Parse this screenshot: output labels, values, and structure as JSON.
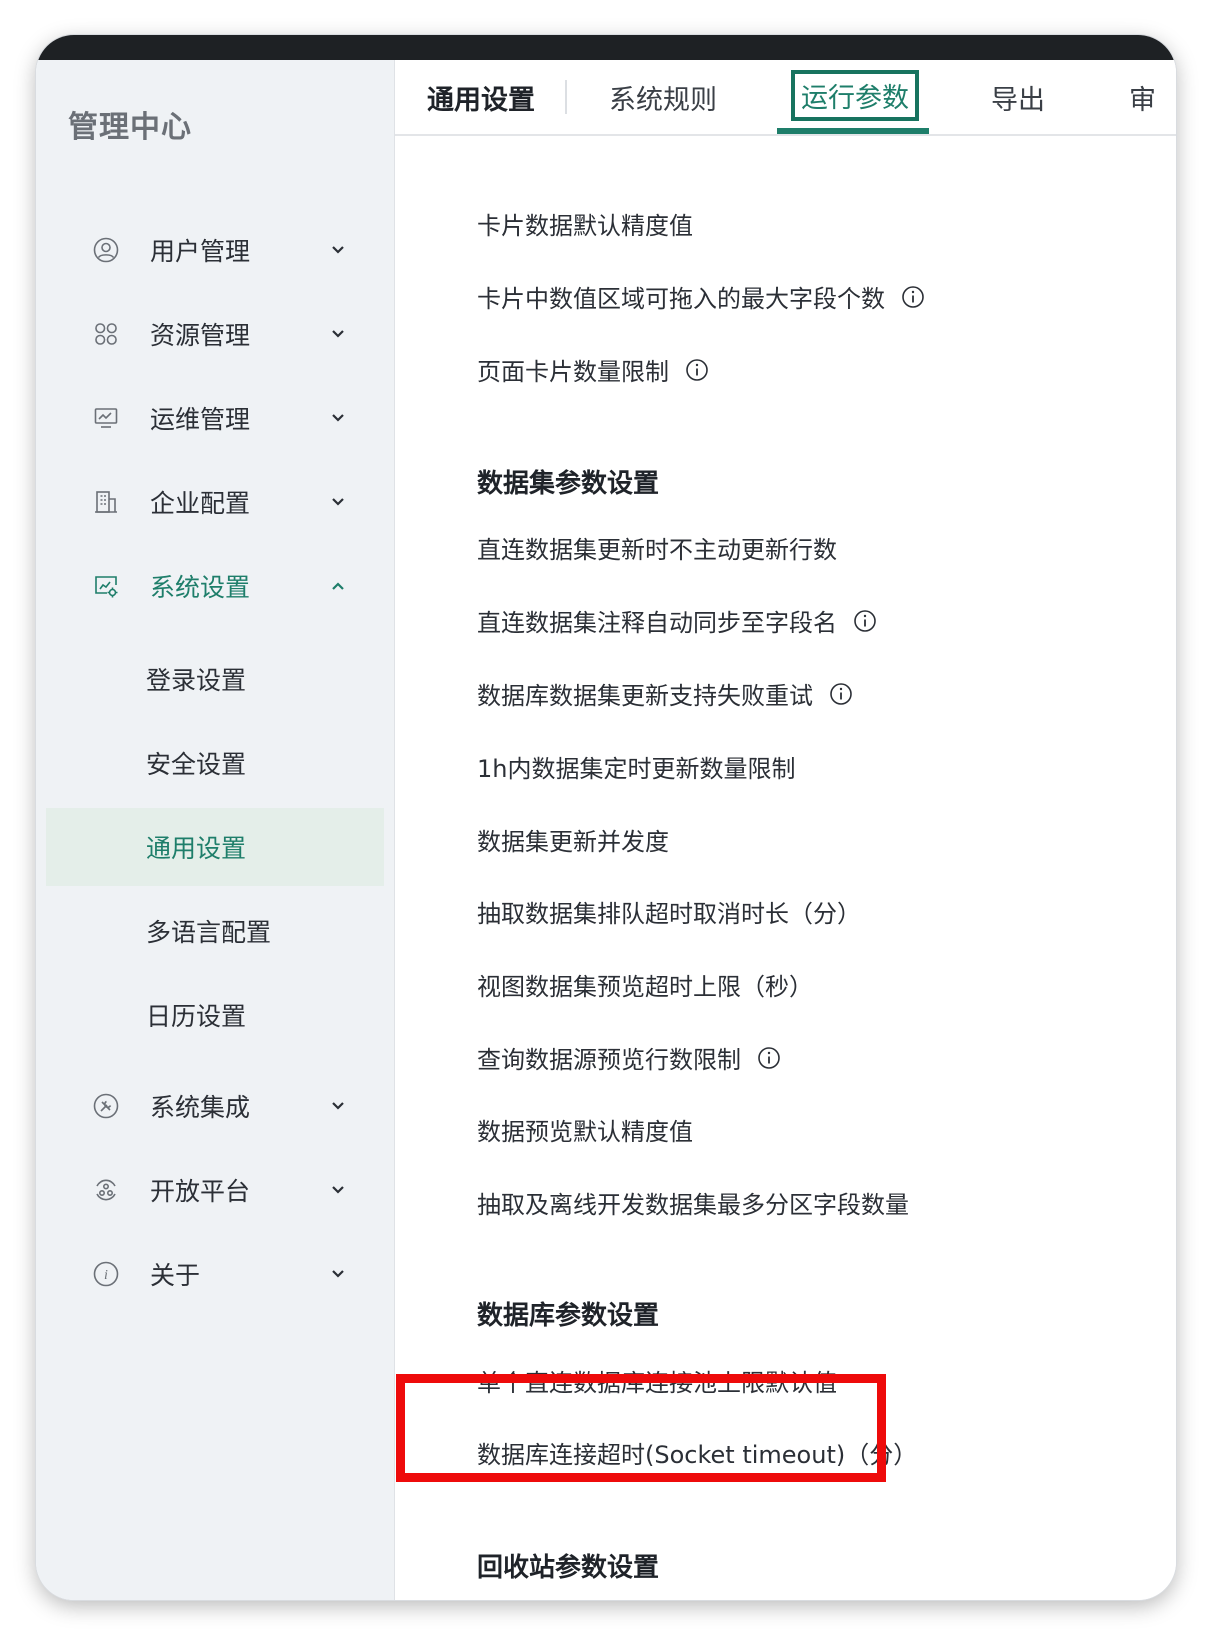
{
  "sidebar": {
    "title": "管理中心",
    "menu": [
      {
        "label": "用户管理",
        "icon": "user-circle-icon"
      },
      {
        "label": "资源管理",
        "icon": "grid-icon"
      },
      {
        "label": "运维管理",
        "icon": "monitor-icon"
      },
      {
        "label": "企业配置",
        "icon": "building-icon"
      },
      {
        "label": "系统设置",
        "icon": "system-settings-icon",
        "expanded": true
      },
      {
        "label": "系统集成",
        "icon": "tools-icon"
      },
      {
        "label": "开放平台",
        "icon": "open-platform-icon"
      },
      {
        "label": "关于",
        "icon": "info-icon"
      }
    ],
    "submenu": [
      {
        "label": "登录设置"
      },
      {
        "label": "安全设置"
      },
      {
        "label": "通用设置",
        "selected": true
      },
      {
        "label": "多语言配置"
      },
      {
        "label": "日历设置"
      }
    ]
  },
  "tabs": {
    "general": "通用设置",
    "rules": "系统规则",
    "runtime": "运行参数",
    "export": "导出",
    "partial": "审"
  },
  "card_params": [
    {
      "label": "卡片数据默认精度值",
      "info": false
    },
    {
      "label": "卡片中数值区域可拖入的最大字段个数",
      "info": true
    },
    {
      "label": "页面卡片数量限制",
      "info": true
    }
  ],
  "dataset_section": {
    "title": "数据集参数设置",
    "items": [
      {
        "label": "直连数据集更新时不主动更新行数",
        "info": false
      },
      {
        "label": "直连数据集注释自动同步至字段名",
        "info": true
      },
      {
        "label": "数据库数据集更新支持失败重试",
        "info": true
      },
      {
        "label": "1h内数据集定时更新数量限制",
        "info": false
      },
      {
        "label": "数据集更新并发度",
        "info": false
      },
      {
        "label": "抽取数据集排队超时取消时长（分）",
        "info": false
      },
      {
        "label": "视图数据集预览超时上限（秒）",
        "info": false
      },
      {
        "label": "查询数据源预览行数限制",
        "info": true
      },
      {
        "label": "数据预览默认精度值",
        "info": false
      },
      {
        "label": "抽取及离线开发数据集最多分区字段数量",
        "info": false
      }
    ]
  },
  "database_section": {
    "title": "数据库参数设置",
    "items": [
      {
        "label": "单个直连数据库连接池上限默认值"
      },
      {
        "label": "数据库连接超时(Socket timeout)（分）"
      }
    ]
  },
  "recycle_section": {
    "title": "回收站参数设置"
  },
  "colors": {
    "accent": "#1e7e6a",
    "highlight": "#ee0b0b",
    "sidebar_bg": "#eff2f5"
  }
}
